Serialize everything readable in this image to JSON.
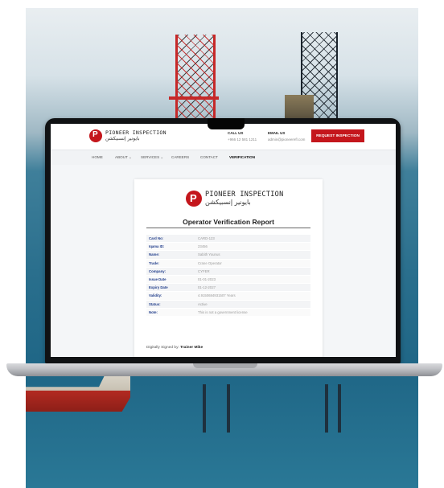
{
  "brand": {
    "name_en": "PIONEER INSPECTION",
    "name_ar": "بايونير إنسبيكشن"
  },
  "header": {
    "call_label": "CALL US",
    "call_value": "+966 12 581 1211",
    "email_label": "EMAIL US",
    "email_value": "admin@pioneerefl.com",
    "cta_label": "REQUEST INSPECTION"
  },
  "nav": {
    "items": [
      "HOME",
      "ABOUT ⌄",
      "SERVICES ⌄",
      "CAREERS",
      "CONTACT",
      "VERIFICATION"
    ],
    "active": "VERIFICATION"
  },
  "report": {
    "title": "Operator Verification Report",
    "rows": [
      {
        "label": "Card No:",
        "value": "CARD-123"
      },
      {
        "label": "Iqama ID:",
        "value": "23456"
      },
      {
        "label": "Name:",
        "value": "Sabith Younus"
      },
      {
        "label": "Trade:",
        "value": "Crane Operator"
      },
      {
        "label": "Company:",
        "value": "CYFER"
      },
      {
        "label": "Issue Date",
        "value": "01-01-2023"
      },
      {
        "label": "Expiry Date",
        "value": "01-12-2027"
      },
      {
        "label": "Validity:",
        "value": "4.9150684931507 Years"
      },
      {
        "label": "Status:",
        "value": "Active"
      },
      {
        "label": "Note:",
        "value": "This is not a government license"
      }
    ],
    "signed_prefix": "Digitally Signed by:",
    "signed_name": "Trainer Mike"
  },
  "colors": {
    "brand_red": "#c4161c",
    "label_blue": "#1f3c8a"
  }
}
